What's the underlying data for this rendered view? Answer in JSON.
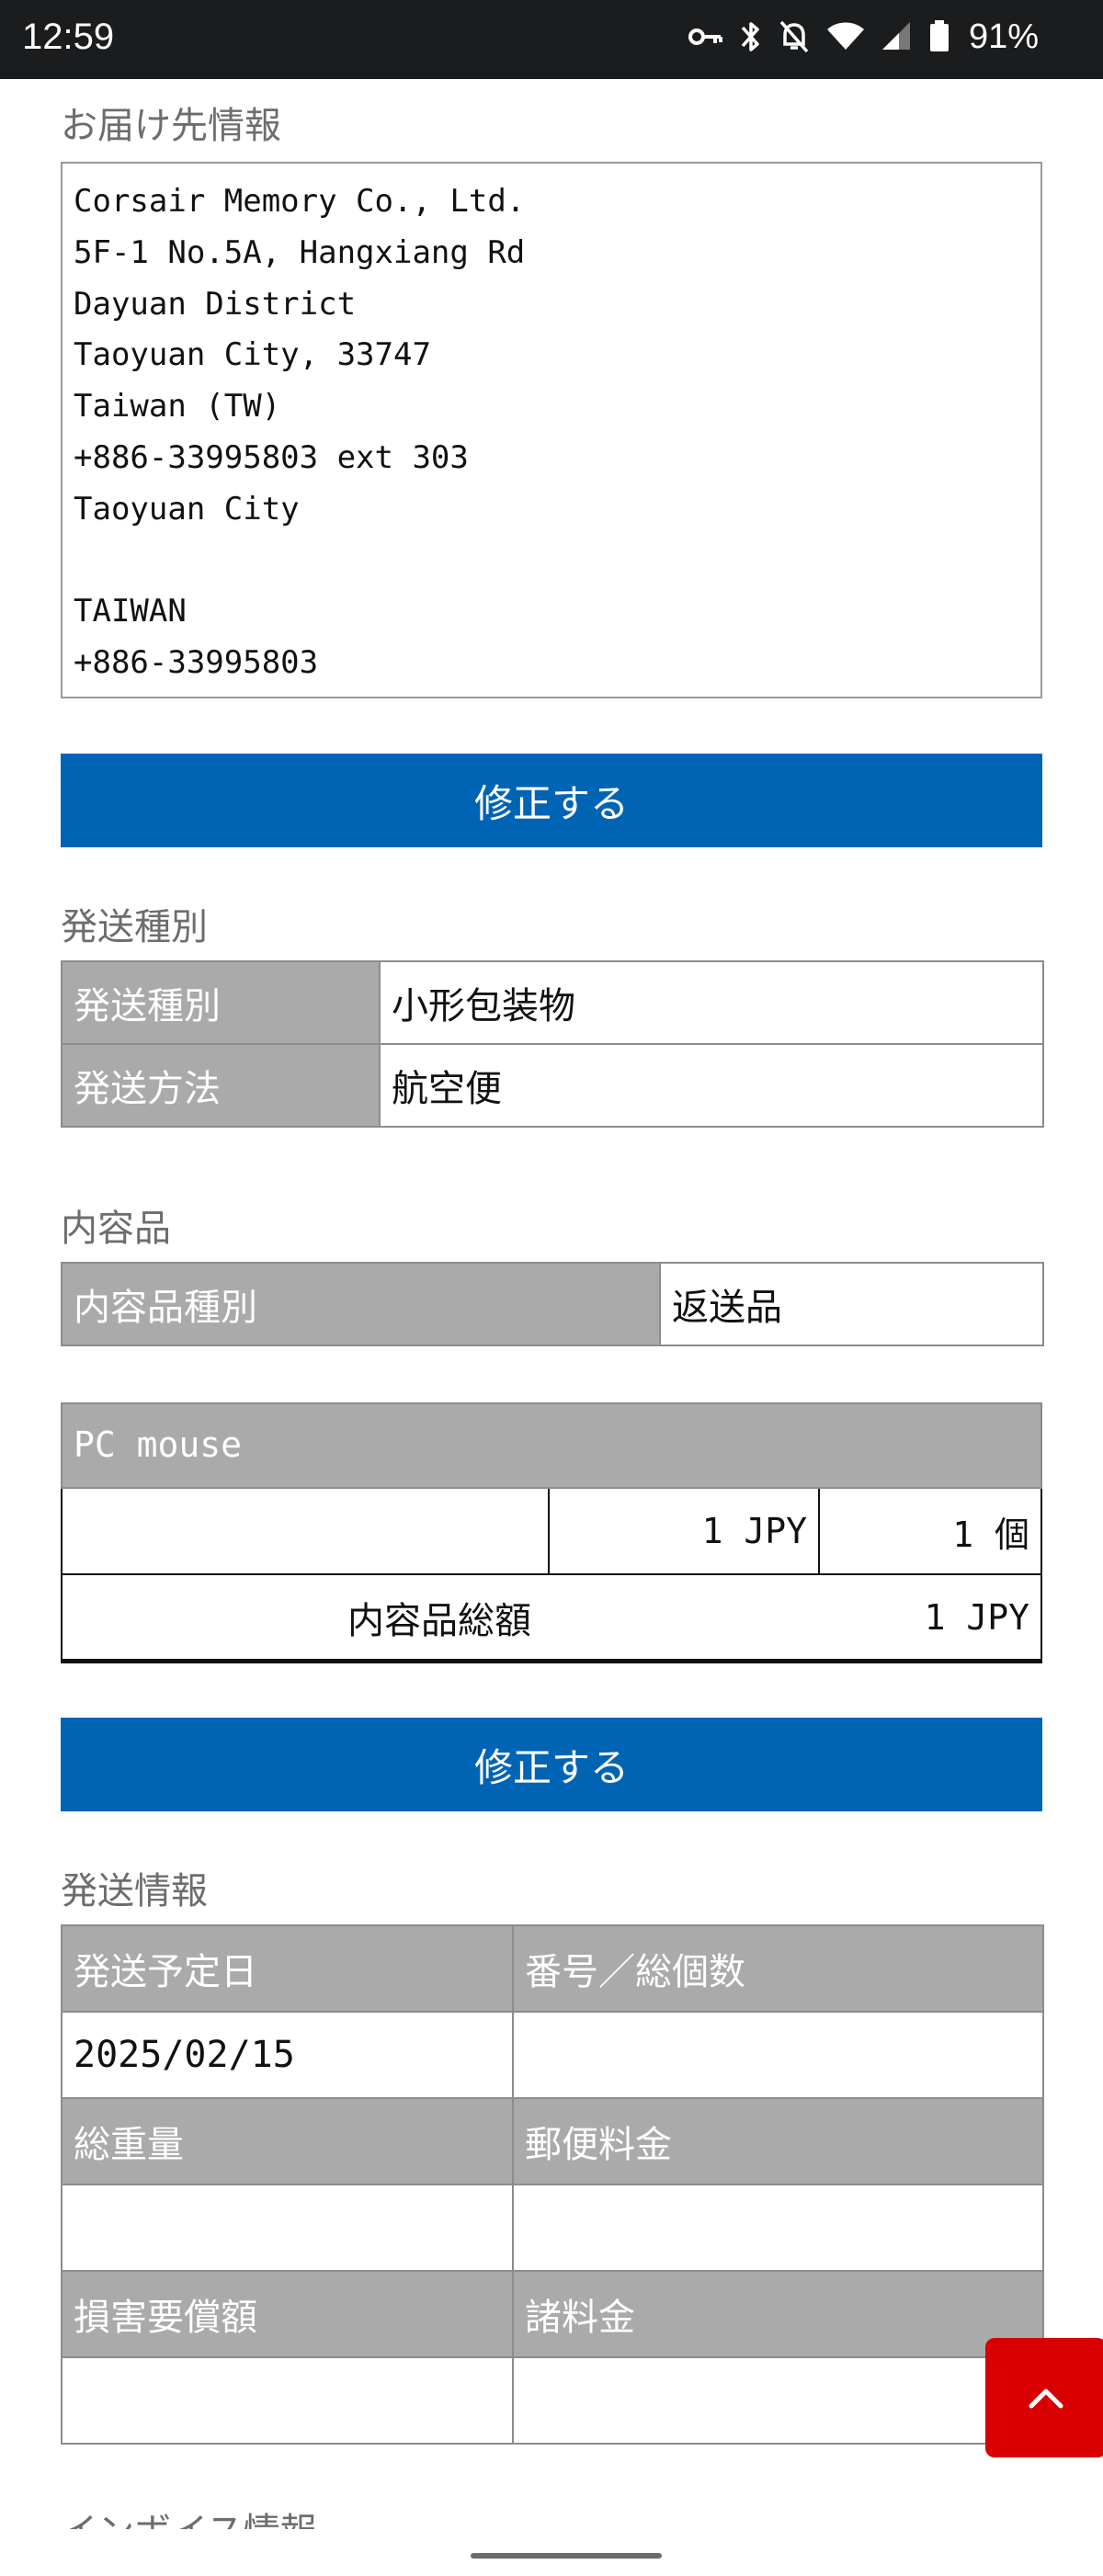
{
  "status_bar": {
    "time": "12:59",
    "battery": "91%",
    "icons": [
      "vpn-key-icon",
      "bluetooth-icon",
      "notifications-off-icon",
      "wifi-icon",
      "cellular-signal-icon",
      "battery-icon"
    ]
  },
  "shipping_address": {
    "section_title": "お届け先情報",
    "lines": [
      "Corsair Memory Co., Ltd.",
      "5F-1 No.5A, Hangxiang Rd",
      "Dayuan District",
      "Taoyuan City, 33747",
      "Taiwan (TW)",
      "+886-33995803 ext 303",
      "Taoyuan City",
      "",
      "TAIWAN",
      "+886-33995803"
    ],
    "edit_label": "修正する"
  },
  "shipment_type": {
    "section_title": "発送種別",
    "rows": [
      {
        "label": "発送種別",
        "value": "小形包装物"
      },
      {
        "label": "発送方法",
        "value": "航空便"
      }
    ]
  },
  "contents": {
    "section_title": "内容品",
    "type_label": "内容品種別",
    "type_value": "返送品",
    "item": {
      "name": "PC mouse",
      "description": "",
      "price": "1 JPY",
      "quantity": "1 個"
    },
    "total_label": "内容品総額",
    "total_value": "1 JPY",
    "edit_label": "修正する"
  },
  "shipping_info": {
    "section_title": "発送情報",
    "rows": [
      {
        "left_label": "発送予定日",
        "right_label": "番号／総個数",
        "left_value": "2025/02/15",
        "right_value": ""
      },
      {
        "left_label": "総重量",
        "right_label": "郵便料金",
        "left_value": "",
        "right_value": ""
      },
      {
        "left_label": "損害要償額",
        "right_label": "諸料金",
        "left_value": "",
        "right_value": ""
      }
    ]
  },
  "next_section_title": "インボイス情報",
  "colors": {
    "primary_button": "#0064b4",
    "table_header": "#aaaaaa",
    "scroll_top_button": "#d80000",
    "status_bar": "#1b1c1e"
  }
}
